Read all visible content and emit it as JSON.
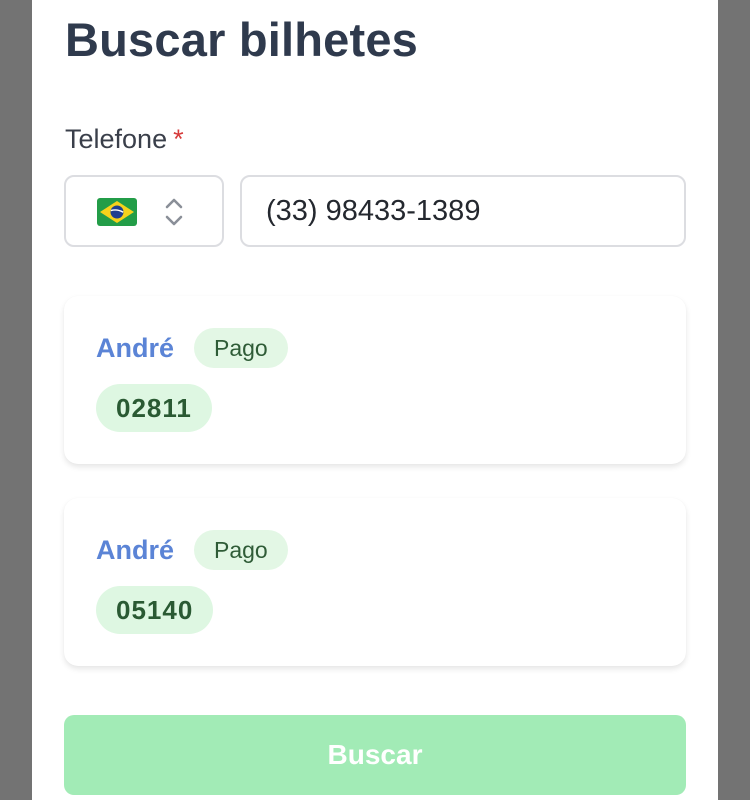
{
  "modal": {
    "title": "Buscar bilhetes"
  },
  "phone_field": {
    "label": "Telefone",
    "required_mark": "*",
    "country_flag_icon": "brazil-flag-icon",
    "selector_icon": "chevron-up-down-icon",
    "value": "(33) 98433-1389"
  },
  "tickets": [
    {
      "buyer": "André",
      "status": "Pago",
      "number": "02811"
    },
    {
      "buyer": "André",
      "status": "Pago",
      "number": "05140"
    }
  ],
  "search_button": {
    "label": "Buscar"
  },
  "colors": {
    "title": "#2f3a4d",
    "required": "#d63b3b",
    "buyer_name": "#5b84d6",
    "badge_bg": "#e3f7e5",
    "button_bg": "#a2ebb6"
  }
}
